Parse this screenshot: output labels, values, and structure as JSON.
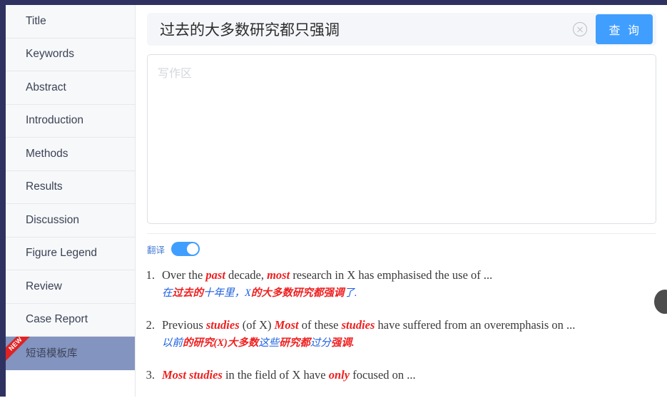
{
  "sidebar": {
    "items": [
      {
        "label": "Title",
        "active": false,
        "badge": null
      },
      {
        "label": "Keywords",
        "active": false,
        "badge": null
      },
      {
        "label": "Abstract",
        "active": false,
        "badge": null
      },
      {
        "label": "Introduction",
        "active": false,
        "badge": null
      },
      {
        "label": "Methods",
        "active": false,
        "badge": null
      },
      {
        "label": "Results",
        "active": false,
        "badge": null
      },
      {
        "label": "Discussion",
        "active": false,
        "badge": null
      },
      {
        "label": "Figure Legend",
        "active": false,
        "badge": null
      },
      {
        "label": "Review",
        "active": false,
        "badge": null
      },
      {
        "label": "Case Report",
        "active": false,
        "badge": null
      },
      {
        "label": "短语模板库",
        "active": true,
        "badge": "NEW"
      }
    ]
  },
  "search": {
    "value": "过去的大多数研究都只强调",
    "placeholder": "",
    "clear_icon": "close-circle-icon",
    "button_label": "查 询",
    "button_color": "#409eff"
  },
  "editor": {
    "placeholder": "写作区",
    "value": ""
  },
  "translate": {
    "label": "翻译",
    "enabled": true,
    "accent_color": "#409eff",
    "label_color": "#4a7fd6"
  },
  "results": {
    "items": [
      {
        "number": "1.",
        "english": [
          {
            "text": "Over the ",
            "highlight": false
          },
          {
            "text": "past",
            "highlight": true
          },
          {
            "text": " decade, ",
            "highlight": false
          },
          {
            "text": "most",
            "highlight": true
          },
          {
            "text": " research in X has emphasised the use of ...",
            "highlight": false
          }
        ],
        "chinese": [
          {
            "text": "在",
            "color": "blue"
          },
          {
            "text": "过去的",
            "color": "red"
          },
          {
            "text": "十年里，X",
            "color": "blue"
          },
          {
            "text": "的大多数研究都强调",
            "color": "red"
          },
          {
            "text": "了.",
            "color": "blue"
          }
        ]
      },
      {
        "number": "2.",
        "english": [
          {
            "text": "Previous ",
            "highlight": false
          },
          {
            "text": "studies",
            "highlight": true
          },
          {
            "text": " (of X) ",
            "highlight": false
          },
          {
            "text": "Most",
            "highlight": true
          },
          {
            "text": " of these ",
            "highlight": false
          },
          {
            "text": "studies",
            "highlight": true
          },
          {
            "text": " have suffered from an overemphasis on ...",
            "highlight": false
          }
        ],
        "chinese": [
          {
            "text": "以前",
            "color": "blue"
          },
          {
            "text": "的研究(X)大多数",
            "color": "red"
          },
          {
            "text": "这些",
            "color": "blue"
          },
          {
            "text": "研究都",
            "color": "red"
          },
          {
            "text": "过分",
            "color": "blue"
          },
          {
            "text": "强调.",
            "color": "red"
          }
        ]
      },
      {
        "number": "3.",
        "english": [
          {
            "text": "Most studies",
            "highlight": true
          },
          {
            "text": " in the field of X have ",
            "highlight": false
          },
          {
            "text": "only",
            "highlight": true
          },
          {
            "text": " focused on ...",
            "highlight": false
          }
        ],
        "chinese": []
      }
    ]
  },
  "float_button": {
    "name": "floating-action-button",
    "color": "#4d4d4d"
  }
}
